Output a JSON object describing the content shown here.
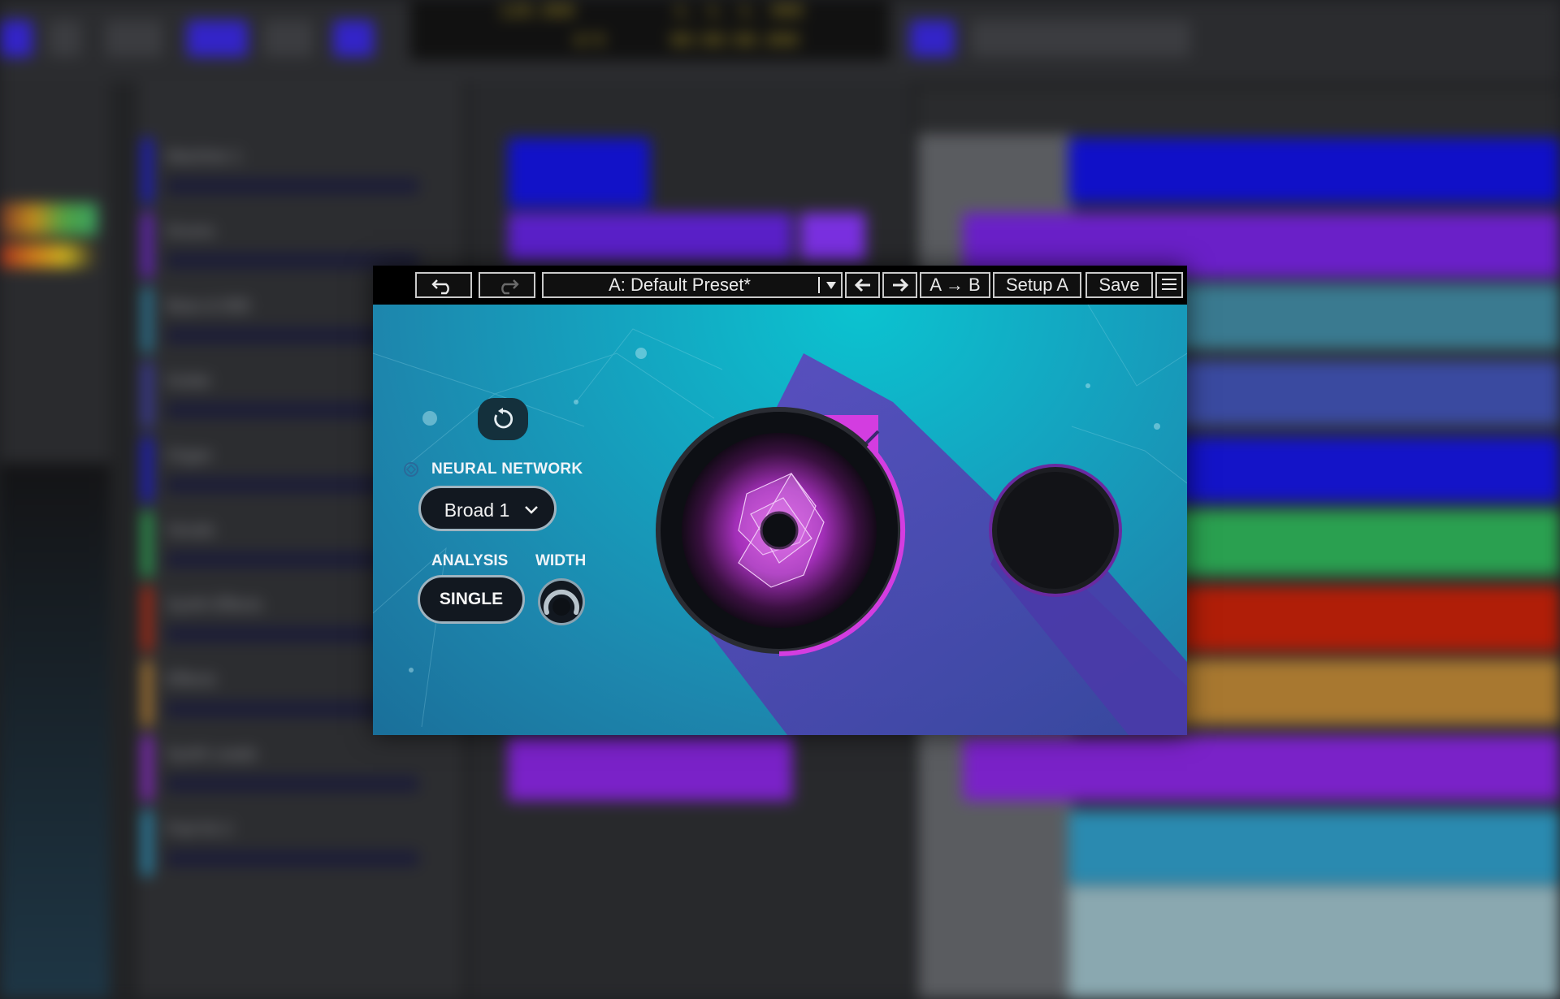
{
  "toolbar": {
    "preset_name": "A: Default Preset*",
    "ab_label": "A → B",
    "setup_label": "Setup A",
    "save_label": "Save"
  },
  "plugin": {
    "nn_label": "NEURAL NETWORK",
    "nn_value": "Broad 1",
    "analysis_label": "ANALYSIS",
    "analysis_value": "SINGLE",
    "width_label": "WIDTH"
  },
  "colors": {
    "accent": "#d33de0",
    "panel_bg": "#14a4c0",
    "toolbar_bg": "#000000"
  },
  "icons": [
    "undo-icon",
    "redo-icon",
    "dropdown-arrow-icon",
    "arrow-left-icon",
    "arrow-right-icon",
    "menu-icon",
    "reset-icon",
    "neural-network-icon",
    "chevron-down-icon"
  ]
}
